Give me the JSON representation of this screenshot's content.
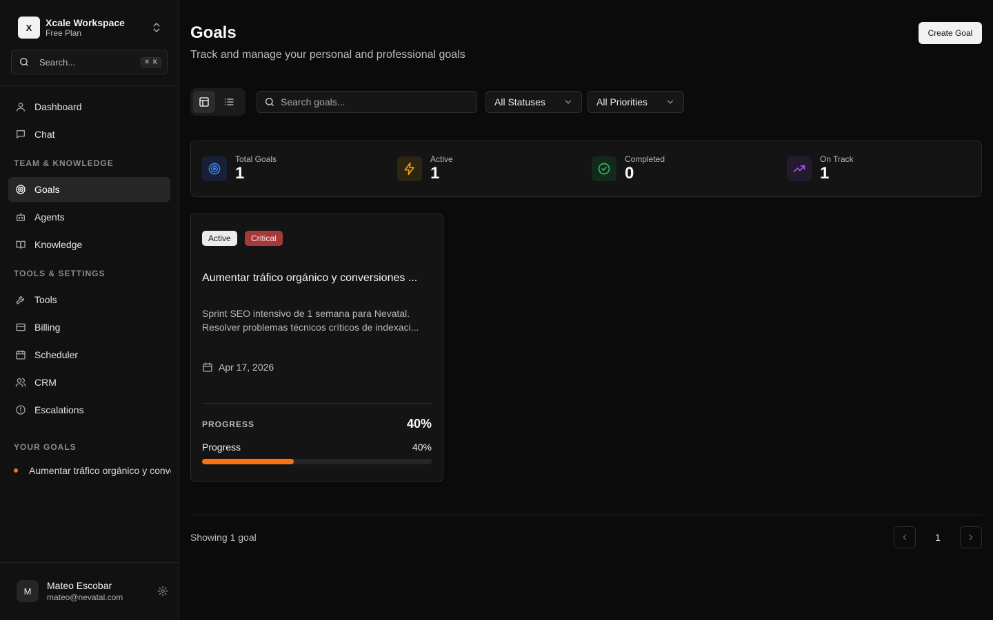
{
  "workspace": {
    "initial": "X",
    "name": "Xcale Workspace",
    "plan": "Free Plan"
  },
  "sidebar": {
    "search_placeholder": "Search...",
    "search_shortcut": "⌘ K",
    "nav_top": [
      {
        "label": "Dashboard",
        "icon": "user-icon"
      },
      {
        "label": "Chat",
        "icon": "chat-icon"
      }
    ],
    "section_team": "TEAM & KNOWLEDGE",
    "nav_team": [
      {
        "label": "Goals",
        "icon": "target-icon",
        "active": true
      },
      {
        "label": "Agents",
        "icon": "bot-icon"
      },
      {
        "label": "Knowledge",
        "icon": "book-icon"
      }
    ],
    "section_tools": "TOOLS & SETTINGS",
    "nav_tools": [
      {
        "label": "Tools",
        "icon": "wrench-icon"
      },
      {
        "label": "Billing",
        "icon": "credit-card-icon"
      },
      {
        "label": "Scheduler",
        "icon": "calendar-icon"
      },
      {
        "label": "CRM",
        "icon": "users-icon"
      },
      {
        "label": "Escalations",
        "icon": "alert-circle-icon"
      }
    ],
    "section_goals": "YOUR GOALS",
    "goal_link": "Aumentar tráfico orgánico y conversiones",
    "user": {
      "initial": "M",
      "name": "Mateo Escobar",
      "email": "mateo@nevatal.com"
    }
  },
  "header": {
    "title": "Goals",
    "subtitle": "Track and manage your personal and professional goals",
    "create_label": "Create Goal"
  },
  "filters": {
    "search_placeholder": "Search goals...",
    "status_value": "All Statuses",
    "priority_value": "All Priorities"
  },
  "stats": [
    {
      "label": "Total Goals",
      "value": "1",
      "icon": "target-icon",
      "color": "#3b82f6"
    },
    {
      "label": "Active",
      "value": "1",
      "icon": "lightning-icon",
      "color": "#f59e0b"
    },
    {
      "label": "Completed",
      "value": "0",
      "icon": "check-circle-icon",
      "color": "#22c55e"
    },
    {
      "label": "On Track",
      "value": "1",
      "icon": "trending-up-icon",
      "color": "#a855f7"
    }
  ],
  "goal_card": {
    "status": "Active",
    "priority": "Critical",
    "title": "Aumentar tráfico orgánico y conversiones ...",
    "description": "Sprint SEO intensivo de 1 semana para Nevatal. Resolver problemas técnicos críticos de indexaci...",
    "date": "Apr 17, 2026",
    "progress_heading": "PROGRESS",
    "progress_heading_value": "40%",
    "progress_label": "Progress",
    "progress_value": "40%",
    "progress_percent": 40,
    "accent": "#f97316"
  },
  "footer": {
    "showing": "Showing 1 goal",
    "page": "1"
  }
}
